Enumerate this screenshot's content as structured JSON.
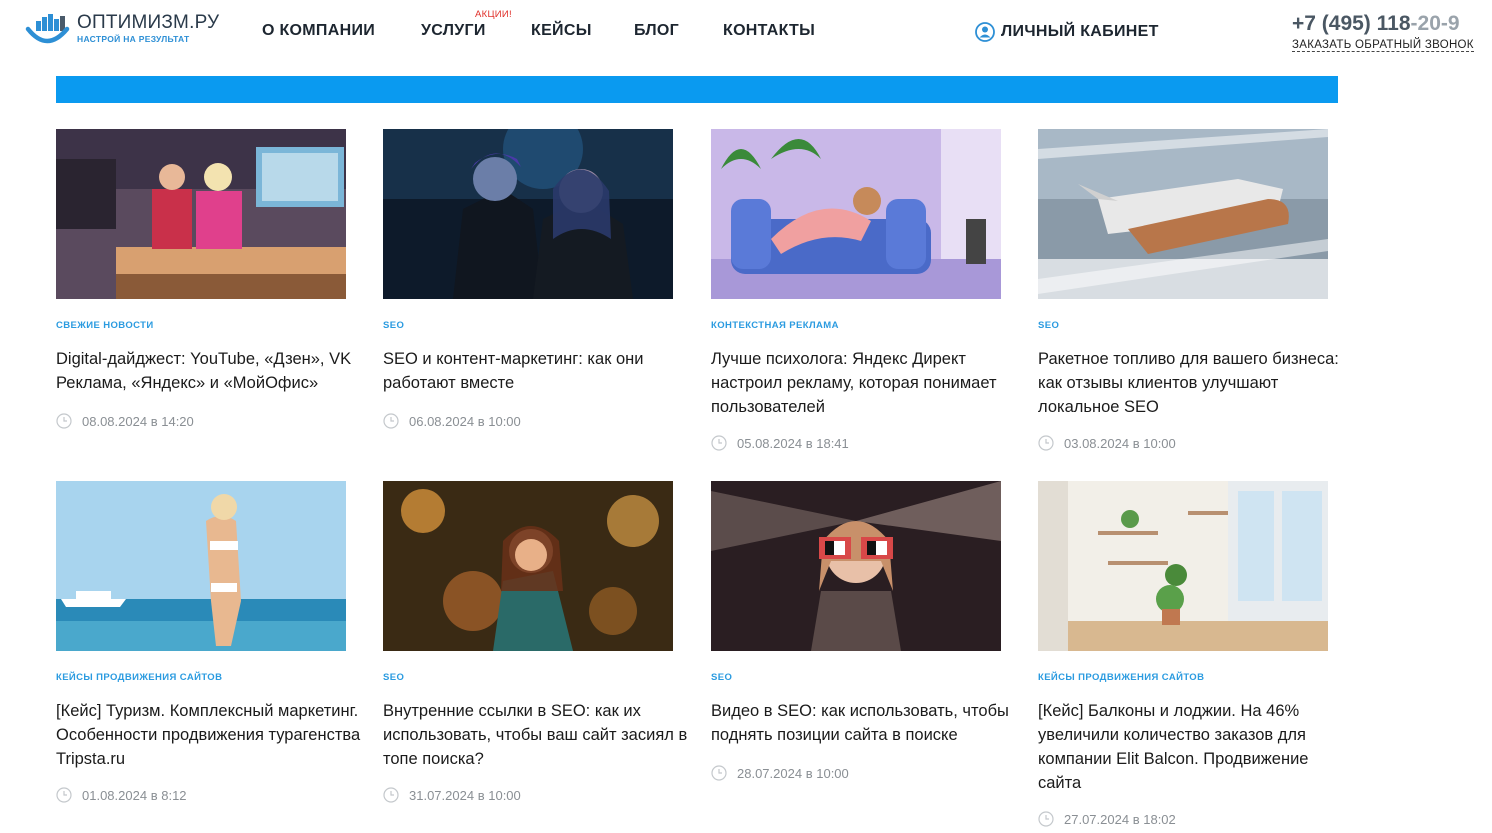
{
  "header": {
    "logo_name": "ОПТИМИЗМ.РУ",
    "logo_slogan": "НАСТРОЙ НА РЕЗУЛЬТАТ",
    "nav": [
      {
        "label": "О КОМПАНИИ"
      },
      {
        "label": "УСЛУГИ"
      },
      {
        "label": "КЕЙСЫ"
      },
      {
        "label": "БЛОГ"
      },
      {
        "label": "КОНТАКТЫ"
      }
    ],
    "promo_badge": "АКЦИИ!",
    "cabinet_label": "ЛИЧНЫЙ КАБИНЕТ",
    "cabinet_icon": "user-circle-icon",
    "phone_main": "+7 (495) 118",
    "phone_faded": "-20-9",
    "callback": "ЗАКАЗАТЬ ОБРАТНЫЙ ЗВОНОК"
  },
  "colors": {
    "accent": "#0a9af0",
    "category": "#2b9be0",
    "promo": "#e0302a",
    "logo_blue": "#2d8fd5"
  },
  "articles": [
    {
      "category": "СВЕЖИЕ НОВОСТИ",
      "title": "Digital-дайджест: YouTube, «Дзен», VK Реклама, «Яндекс» и «МойОфис»",
      "date": "08.08.2024",
      "at": "в",
      "time": "14:20"
    },
    {
      "category": "SEO",
      "title": "SEO и контент-маркетинг: как они работают вместе",
      "date": "06.08.2024",
      "at": "в",
      "time": "10:00"
    },
    {
      "category": "КОНТЕКСТНАЯ РЕКЛАМА",
      "title": "Лучше психолога: Яндекс Директ настроил рекламу, которая понимает пользователей",
      "date": "05.08.2024",
      "at": "в",
      "time": "18:41"
    },
    {
      "category": "SEO",
      "title": "Ракетное топливо для вашего бизнеса: как отзывы клиентов улучшают локальное SEO",
      "date": "03.08.2024",
      "at": "в",
      "time": "10:00"
    },
    {
      "category": "КЕЙСЫ ПРОДВИЖЕНИЯ САЙТОВ",
      "title": "[Кейс] Туризм. Комплексный маркетинг. Особенности продвижения турагенства Tripsta.ru",
      "date": "01.08.2024",
      "at": "в",
      "time": "8:12"
    },
    {
      "category": "SEO",
      "title": "Внутренние ссылки в SEO: как их использовать, чтобы ваш сайт засиял в топе поиска?",
      "date": "31.07.2024",
      "at": "в",
      "time": "10:00"
    },
    {
      "category": "SEO",
      "title": "Видео в SEO: как использовать, чтобы поднять позиции сайта в поиске",
      "date": "28.07.2024",
      "at": "в",
      "time": "10:00"
    },
    {
      "category": "КЕЙСЫ ПРОДВИЖЕНИЯ САЙТОВ",
      "title": "[Кейс] Балконы и лоджии. На 46% увеличили количество заказов для компании Elit Balcon. Продвижение сайта",
      "date": "27.07.2024",
      "at": "в",
      "time": "18:02"
    }
  ]
}
